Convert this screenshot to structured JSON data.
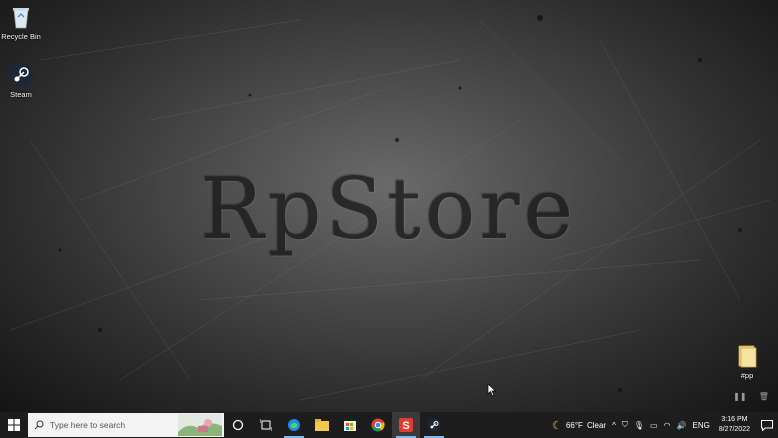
{
  "desktop": {
    "brand_text": "RpStore",
    "icons": [
      {
        "label": "Recycle Bin",
        "icon": "recycle-bin-icon"
      },
      {
        "label": "Steam",
        "icon": "steam-icon"
      },
      {
        "label": "#pp",
        "icon": "folder-icon"
      }
    ]
  },
  "taskbar": {
    "search_placeholder": "Type here to search",
    "apps": [
      "start-icon",
      "cortana-icon",
      "task-view-icon",
      "edge-icon",
      "file-explorer-icon",
      "store-icon",
      "chrome-icon",
      "snagit-icon",
      "steam-icon"
    ],
    "weather": {
      "temp": "66°F",
      "condition": "Clear"
    },
    "language": "ENG",
    "time": "3:16 PM",
    "date": "8/27/2022"
  },
  "colors": {
    "taskbar_bg": "#1d1d1d",
    "accent": "#7fb8f0"
  }
}
